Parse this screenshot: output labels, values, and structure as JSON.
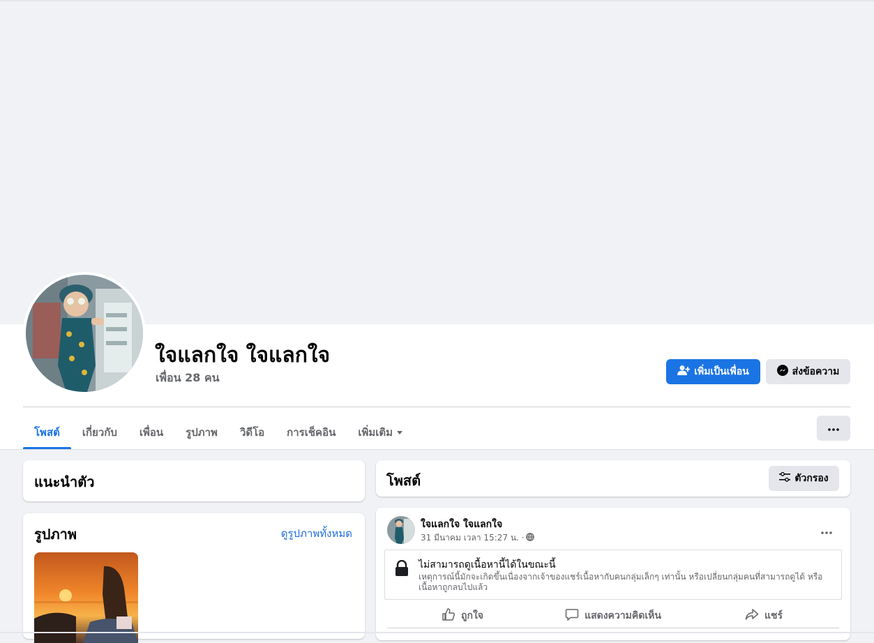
{
  "profile": {
    "name": "ใจแลกใจ ใจแลกใจ",
    "friends_count": "เพื่อน 28 คน"
  },
  "actions": {
    "add_friend": "เพิ่มเป็นเพื่อน",
    "message": "ส่งข้อความ"
  },
  "tabs": [
    {
      "label": "โพสต์",
      "active": true
    },
    {
      "label": "เกี่ยวกับ"
    },
    {
      "label": "เพื่อน"
    },
    {
      "label": "รูปภาพ"
    },
    {
      "label": "วิดีโอ"
    },
    {
      "label": "การเช็คอิน"
    },
    {
      "label": "เพิ่มเติม"
    }
  ],
  "intro": {
    "title": "แนะนำตัว"
  },
  "photos": {
    "title": "รูปภาพ",
    "see_all": "ดูรูปภาพทั้งหมด"
  },
  "posts": {
    "title": "โพสต์",
    "filter_label": "ตัวกรอง"
  },
  "post": {
    "author": "ใจแลกใจ ใจแลกใจ",
    "timestamp": "31 มีนาคม เวลา 15:27 น. ·",
    "notice_title": "ไม่สามารถดูเนื้อหานี้ได้ในขณะนี้",
    "notice_body": "เหตุการณ์นี้มักจะเกิดขึ้นเนื่องจากเจ้าของแชร์เนื้อหากับคนกลุ่มเล็กๆ เท่านั้น หรือเปลี่ยนกลุ่มคนที่สามารถดูได้ หรือเนื้อหาถูกลบไปแล้ว",
    "like": "ถูกใจ",
    "comment": "แสดงความคิดเห็น",
    "share": "แชร์"
  },
  "colors": {
    "primary": "#1b74e4",
    "background": "#f0f2f5",
    "secondary_button": "#e4e6eb",
    "muted_text": "#65676b"
  }
}
